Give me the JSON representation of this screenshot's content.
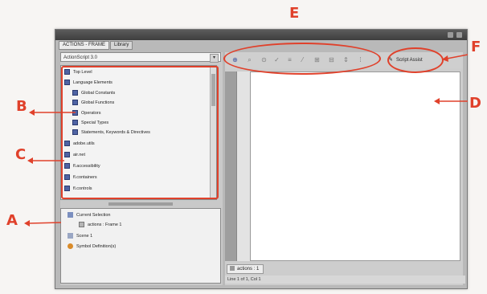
{
  "callouts": {
    "a": "A",
    "b": "B",
    "c": "C",
    "d": "D",
    "e": "E",
    "f": "F"
  },
  "panel": {
    "tabs": [
      "ACTIONS - FRAME",
      "Library"
    ],
    "language_select": "ActionScript 3.0"
  },
  "toolbox": {
    "items": [
      {
        "label": "Top Level",
        "icon": "book-icon"
      },
      {
        "label": "Language Elements",
        "icon": "book-icon"
      },
      {
        "label": "Global Constants",
        "icon": "book-icon"
      },
      {
        "label": "Global Functions",
        "icon": "book-icon"
      },
      {
        "label": "Operators",
        "icon": "book-icon"
      },
      {
        "label": "Special Types",
        "icon": "book-icon"
      },
      {
        "label": "Statements, Keywords & Directives",
        "icon": "book-icon"
      },
      {
        "label": "adobe.utils",
        "icon": "book-icon"
      },
      {
        "label": "air.net",
        "icon": "book-icon"
      },
      {
        "label": "fl.accessibility",
        "icon": "book-icon"
      },
      {
        "label": "fl.containers",
        "icon": "book-icon"
      },
      {
        "label": "fl.controls",
        "icon": "book-icon"
      }
    ]
  },
  "script_navigator": {
    "items": [
      {
        "label": "Current Selection",
        "icon": "folder-icon"
      },
      {
        "label": "actions : Frame 1",
        "icon": "frame-icon"
      },
      {
        "label": "Scene 1",
        "icon": "scene-icon"
      },
      {
        "label": "Symbol Definition(s)",
        "icon": "symbol-icon"
      }
    ]
  },
  "toolbar": {
    "tools": [
      "add-icon",
      "find-icon",
      "target-icon",
      "check-syntax-icon",
      "auto-format-icon",
      "code-hint-icon",
      "debug-icon",
      "collapse-icon",
      "expand-icon",
      "comment-icon"
    ],
    "script_assist_label": "Script Assist"
  },
  "editor": {
    "tab_label": "actions : 1",
    "status_text": "Line 1 of 1, Col 1"
  },
  "colors": {
    "callout": "#e0412b",
    "book_icon": "#4f63a3"
  }
}
